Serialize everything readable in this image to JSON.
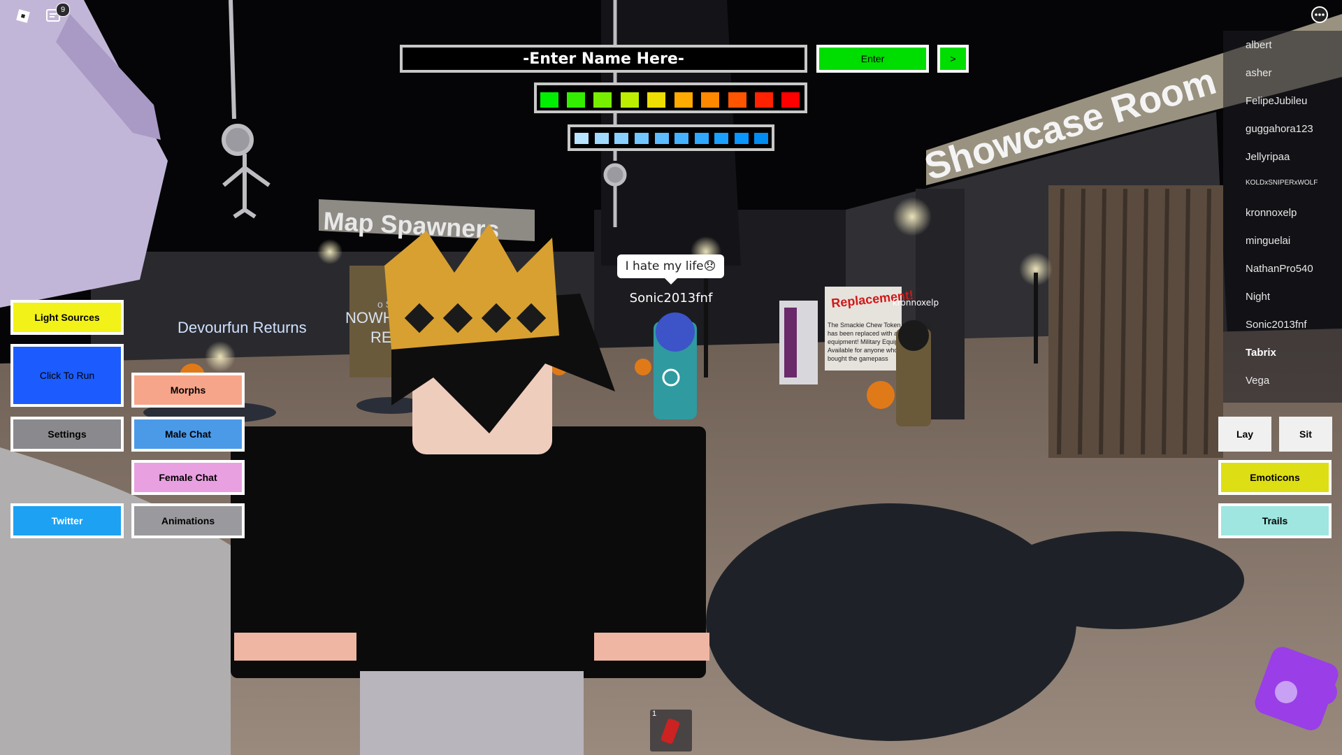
{
  "top_bar": {
    "notification_count": "9"
  },
  "name_entry": {
    "placeholder": "-Enter Name Here-",
    "enter_label": "Enter",
    "arrow_label": ">"
  },
  "color_palette_1": [
    "#00ee00",
    "#33ee00",
    "#77ee00",
    "#bbee00",
    "#eedd00",
    "#ffaa00",
    "#ff8800",
    "#ff5500",
    "#ff2200",
    "#ff0000"
  ],
  "color_palette_2": [
    "#b8e4ff",
    "#a2daff",
    "#8ad0ff",
    "#72c6ff",
    "#5cbcff",
    "#46b2ff",
    "#30a8ff",
    "#1aa0ff",
    "#0896ff",
    "#008cf0"
  ],
  "left_menu": {
    "light_sources": "Light Sources",
    "click_to_run": "Click To Run",
    "settings": "Settings",
    "twitter": "Twitter",
    "morphs": "Morphs",
    "male_chat": "Male Chat",
    "female_chat": "Female Chat",
    "animations": "Animations"
  },
  "right_menu": {
    "lay": "Lay",
    "sit": "Sit",
    "emoticons": "Emoticons",
    "trails": "Trails"
  },
  "player_list": [
    {
      "name": "albert",
      "bold": false
    },
    {
      "name": "asher",
      "bold": false
    },
    {
      "name": "FelipeJubileu",
      "bold": false
    },
    {
      "name": "guggahora123",
      "bold": false
    },
    {
      "name": "Jellyripaa",
      "bold": false
    },
    {
      "name": "KOLDxSNIPERxWOLF",
      "bold": false
    },
    {
      "name": "kronnoxelp",
      "bold": false
    },
    {
      "name": "minguelai",
      "bold": false
    },
    {
      "name": "NathanPro540",
      "bold": false
    },
    {
      "name": "Night",
      "bold": false
    },
    {
      "name": "Sonic2013fnf",
      "bold": false
    },
    {
      "name": "Tabrix",
      "bold": true
    },
    {
      "name": "Vega",
      "bold": false
    }
  ],
  "world": {
    "chat_bubble": "I hate my life",
    "chat_emoji": "😞",
    "player_tag_sonic": "Sonic2013fnf",
    "player_tag_kronno": "kronnoxelp",
    "sign_map_spawners": "Map Spawners",
    "sign_showcase": "Showcase Room",
    "sign_devourfun": "Devourfun Returns",
    "sign_nowhere_1": "NOWHE",
    "sign_nowhere_2": "RE",
    "sign_nowhere_small": "o Sp",
    "sign_replacement": "Replacement!",
    "notice_lines": [
      "The Smackie Chew Token gamepass",
      "has been replaced with a new set",
      "equipment! Military Equipment!",
      "Available for anyone who previo",
      "bought the gamepass"
    ]
  },
  "hotbar": {
    "slot_number": "1"
  },
  "colors": {
    "enter_green": "#00dd00",
    "light_sources_yellow": "#f2f218",
    "click_to_run_blue": "#1c5cff",
    "settings_gray": "#8a8a8e",
    "twitter_blue": "#1da1f2",
    "morphs_salmon": "#f6a58a",
    "male_chat_blue": "#4b9ae8",
    "female_chat_pink": "#e9a0e0",
    "animations_gray": "#9a9a9e",
    "emoticons_yellow": "#dede14",
    "trails_cyan": "#9fe6e0",
    "lay_sit_white": "#f0f0f0"
  }
}
